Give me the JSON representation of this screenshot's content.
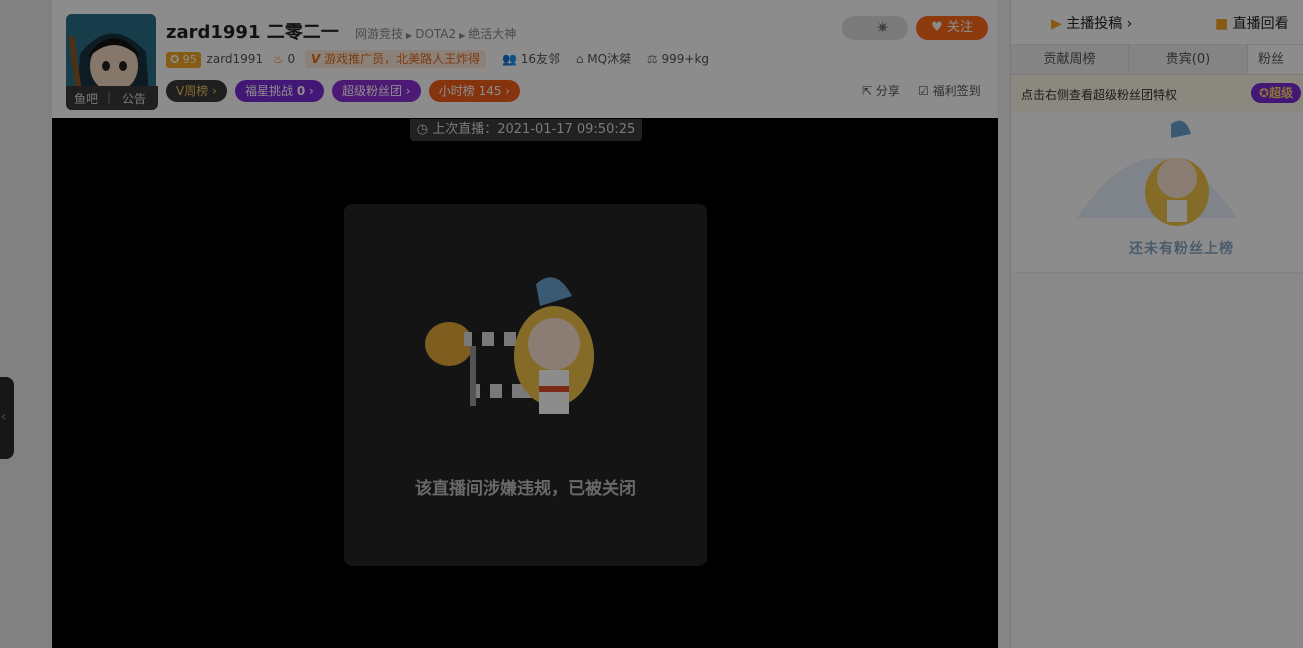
{
  "header": {
    "room_name": "zard1991 二零二一",
    "crumbs": [
      "网游竞技",
      "DOTA2",
      "绝活大神"
    ],
    "avatar_links": [
      "鱼吧",
      "公告"
    ],
    "level_badge": "95",
    "streamer_name": "zard1991",
    "heat_count": "0",
    "promo_text": "游戏推广员，北美路人王炸得",
    "friends": "16友邻",
    "home": "MQ沐桀",
    "weight": "999+kg",
    "follow_label": "关注",
    "pills": {
      "v_rank": "V周榜",
      "lucky_star": "福星挑战",
      "lucky_star_count": "0",
      "super_fan": "超级粉丝团",
      "hour_rank": "小时榜",
      "hour_rank_value": "145"
    },
    "share_label": "分享",
    "signin_label": "福利签到"
  },
  "player": {
    "last_live": "上次直播：2021-01-17 09:50:25",
    "closed_notice": "该直播间涉嫌违规，已被关闭"
  },
  "sidebar": {
    "top_links": [
      "主播投稿",
      "直播回看"
    ],
    "tabs": [
      "贡献周榜",
      "贵宾(0)",
      "粉丝"
    ],
    "fan_hint": "点击右侧查看超级粉丝团特权",
    "fan_badge": "超级",
    "empty_rank_text": "还未有粉丝上榜"
  },
  "colors": {
    "accent_orange": "#ff6a1a",
    "purple": "#7b2bd6",
    "dark_pill": "#3a3a3a",
    "hour_rank_orange": "#f2601a"
  }
}
